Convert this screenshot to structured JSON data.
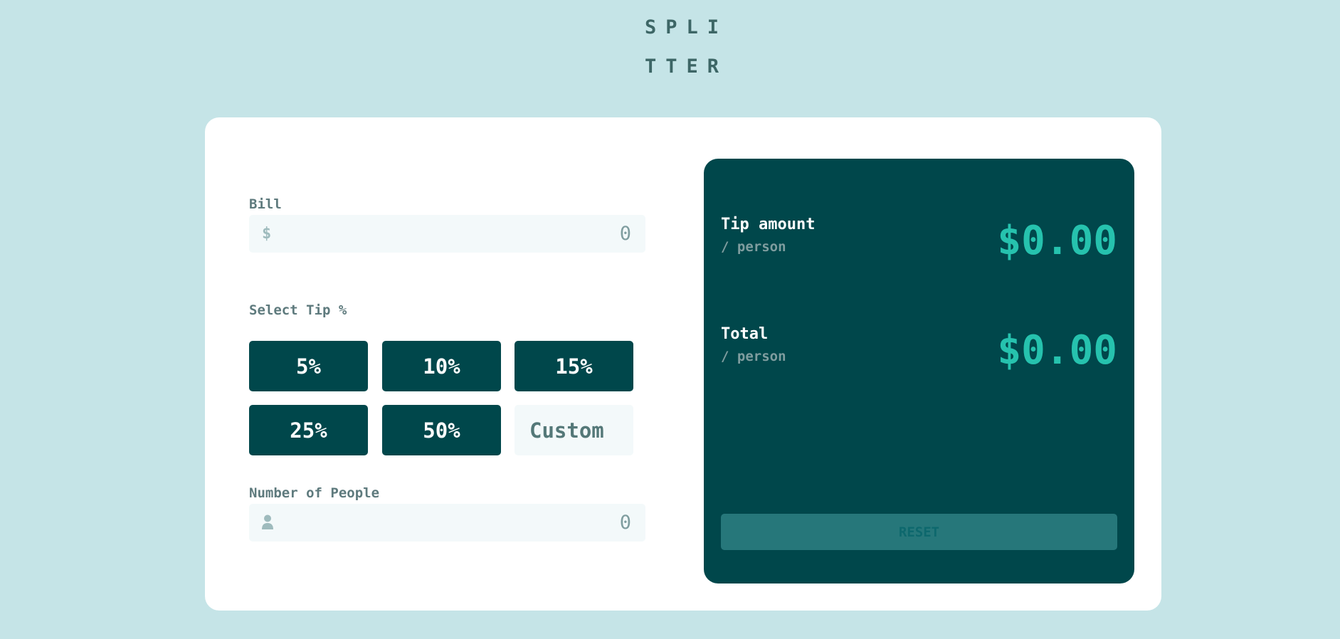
{
  "logo": {
    "line1": "SPLI",
    "line2": "TTER"
  },
  "bill": {
    "label": "Bill",
    "icon": "dollar-icon",
    "icon_glyph": "$",
    "placeholder": "0"
  },
  "tip": {
    "label": "Select Tip %",
    "options": [
      "5%",
      "10%",
      "15%",
      "25%",
      "50%"
    ],
    "custom_placeholder": "Custom"
  },
  "people": {
    "label": "Number of People",
    "icon": "person-icon",
    "placeholder": "0"
  },
  "results": {
    "tip_amount": {
      "title": "Tip amount",
      "sub": "/ person",
      "value": "$0.00"
    },
    "total": {
      "title": "Total",
      "sub": "/ person",
      "value": "$0.00"
    },
    "reset_label": "RESET"
  },
  "colors": {
    "background": "#c5e4e7",
    "primary": "#00474b",
    "accent": "#26c2ae",
    "input_bg": "#f3f9fa",
    "reset_disabled": "#26777a"
  }
}
